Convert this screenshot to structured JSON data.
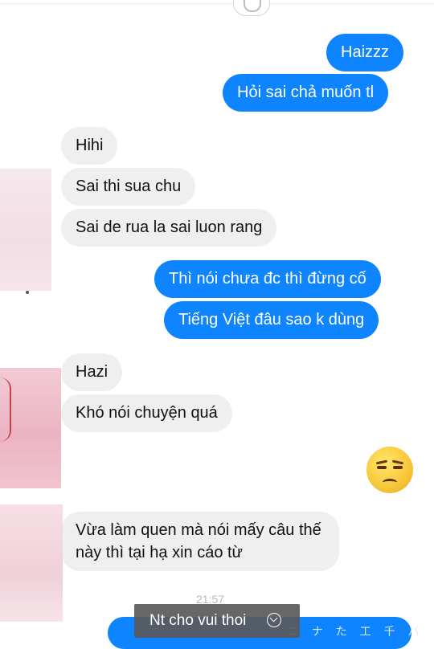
{
  "messages": [
    {
      "text": "Haizzz",
      "direction": "outgoing"
    },
    {
      "text": "Hỏi sai chả muốn tl",
      "direction": "outgoing"
    },
    {
      "text": "Hihi",
      "direction": "incoming"
    },
    {
      "text": "Sai thi sua chu",
      "direction": "incoming"
    },
    {
      "text": "Sai de rua la sai luon rang",
      "direction": "incoming"
    },
    {
      "text": "Thì nói chưa đc thì đừng cố",
      "direction": "outgoing"
    },
    {
      "text": "Tiếng Việt đâu sao k dùng",
      "direction": "outgoing"
    },
    {
      "text": "Hazi",
      "direction": "incoming"
    },
    {
      "text": "Khó nói chuyện quá",
      "direction": "incoming"
    },
    {
      "emoji": "unamused-face",
      "direction": "outgoing"
    },
    {
      "text": "Vừa làm quen mà nói mấy câu thế này thì tại hạ xin cáo từ",
      "direction": "incoming"
    }
  ],
  "timestamp": "21:57",
  "caption": {
    "text": "Nt cho vui thoi",
    "icon": "chevron-down-circle-icon"
  },
  "colors": {
    "outgoing": "#0f84ff",
    "incoming": "#efefef",
    "background": "#ffffff"
  }
}
